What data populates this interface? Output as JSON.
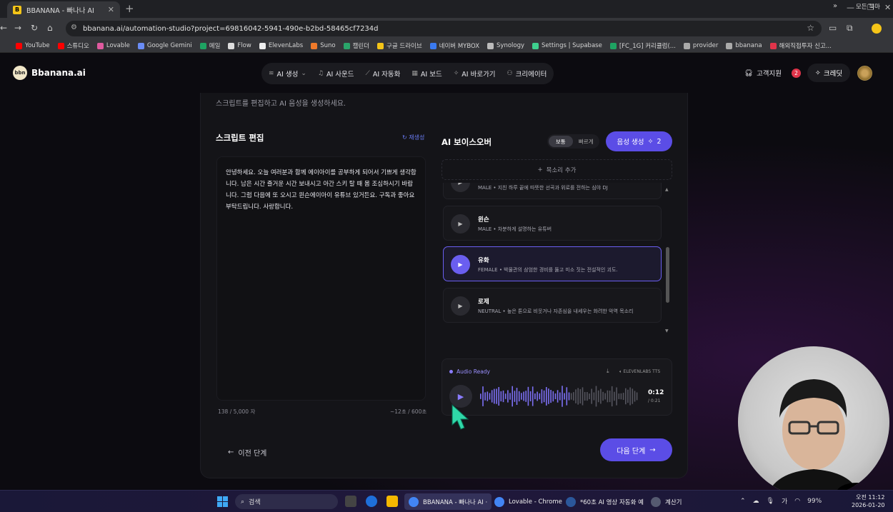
{
  "browser": {
    "tab_title": "BBANANA - 빠나나 AI",
    "tab_favicon": "B",
    "url": "bbanana.ai/automation-studio?project=69816042-5941-490e-b2bd-58465cf7234d",
    "bookmarks": [
      {
        "label": "YouTube",
        "color": "#ff0000"
      },
      {
        "label": "스튜디오",
        "color": "#ff0000"
      },
      {
        "label": "Lovable",
        "color": "#e05aa0"
      },
      {
        "label": "Google Gemini",
        "color": "#6a8cf5"
      },
      {
        "label": "메일",
        "color": "#1ea362"
      },
      {
        "label": "Flow",
        "color": "#dddddd"
      },
      {
        "label": "ElevenLabs",
        "color": "#eeeeee"
      },
      {
        "label": "Suno",
        "color": "#f07a2a"
      },
      {
        "label": "캘린더",
        "color": "#2aa56a"
      },
      {
        "label": "구글 드라이브",
        "color": "#f5c518"
      },
      {
        "label": "네이버 MYBOX",
        "color": "#3a7af0"
      },
      {
        "label": "Synology",
        "color": "#bbbbbb"
      },
      {
        "label": "Settings | Supabase",
        "color": "#3ecf8e"
      },
      {
        "label": "[FC_1G] 커리큘럼(...",
        "color": "#1ea362"
      },
      {
        "label": "provider",
        "color": "#aaaaaa"
      },
      {
        "label": "bbanana",
        "color": "#aaaaaa"
      },
      {
        "label": "해외직접투자 신고...",
        "color": "#e0344a"
      }
    ],
    "bookmarks_more": "»",
    "all_bookmarks": "모든 북마"
  },
  "app": {
    "logo_mark": "bbn",
    "logo_text": "Bbanana.ai",
    "menu": [
      {
        "label": "AI 생성",
        "icon": "layers-icon",
        "glyph": "≋",
        "caret": "⌄"
      },
      {
        "label": "AI 사운드",
        "icon": "music-icon",
        "glyph": "♫",
        "caret": ""
      },
      {
        "label": "AI 자동화",
        "icon": "wand-icon",
        "glyph": "⟋",
        "caret": ""
      },
      {
        "label": "AI 보드",
        "icon": "grid-icon",
        "glyph": "▦",
        "caret": ""
      },
      {
        "label": "AI 바로가기",
        "icon": "sparkle-icon",
        "glyph": "✧",
        "caret": ""
      },
      {
        "label": "크리에이터",
        "icon": "user-icon",
        "glyph": "⚇",
        "caret": ""
      }
    ],
    "support_label": "고객지원",
    "support_badge": "2",
    "credit_label": "크레딧"
  },
  "studio": {
    "subtitle": "스크립트를 편집하고 AI 음성을 생성하세요.",
    "script_title": "스크립트 편집",
    "regen_label": "재생성",
    "script_text": "안녕하세요. 오늘 여러분과 함께 에이아이를 공부하게 되어서 기쁘게 생각합니다. 남은 시간 즐거운 시간 보내시고 아간 스키 탈 때 몸 조심하시기 바랍니다. 그럼 다음에 또 오시고 윈슨에이아이 유튜브 있거든요. 구독과 좋아요 부탁드립니다. 사랑합니다.",
    "char_count": "138 / 5,000 자",
    "duration": "~12초 / 600초",
    "vo_title": "AI 보이스오버",
    "speed_options": [
      "보통",
      "빠르게"
    ],
    "speed_selected": "보통",
    "generate_label": "음성 생성",
    "generate_count": "2",
    "add_voice_label": "목소리 추가",
    "voices": [
      {
        "name": "",
        "desc": "MALE • 지친 하루 끝에 따뜻한 선곡과 위로를 전하는 심야 DJ",
        "selected": false
      },
      {
        "name": "윈슨",
        "desc": "MALE • 차분하게 설명하는 유튜버",
        "selected": false
      },
      {
        "name": "유화",
        "desc": "FEMALE • 박물관의 삼엄한 경비를 뚫고 미소 짓는 전설적인 괴도.",
        "selected": true
      },
      {
        "name": "로제",
        "desc": "NEUTRAL • 높은 톤으로 비웃거나 자존심을 내세우는 화려한 악역 목소리",
        "selected": false
      }
    ],
    "player": {
      "status": "Audio Ready",
      "engine": "ELEVENLABS TTS",
      "time_current": "0:12",
      "time_total": "/ 0:21",
      "progress": 0.57
    },
    "prev_label": "이전 단계",
    "next_label": "다음 단계"
  },
  "taskbar": {
    "search_label": "검색",
    "apps": [
      {
        "label": "BBANANA - 빠나나 AI ·",
        "color": "#4285f4",
        "active": true
      },
      {
        "label": "Lovable - Chrome",
        "color": "#4285f4",
        "active": false
      },
      {
        "label": "*60초 AI 영상 자동화 예",
        "color": "#2b579a",
        "active": false
      },
      {
        "label": "계산기",
        "color": "#555a70",
        "active": false
      }
    ],
    "battery": "99%",
    "ime": "가",
    "time": "오전 11:12",
    "date": "2026-01-20"
  }
}
